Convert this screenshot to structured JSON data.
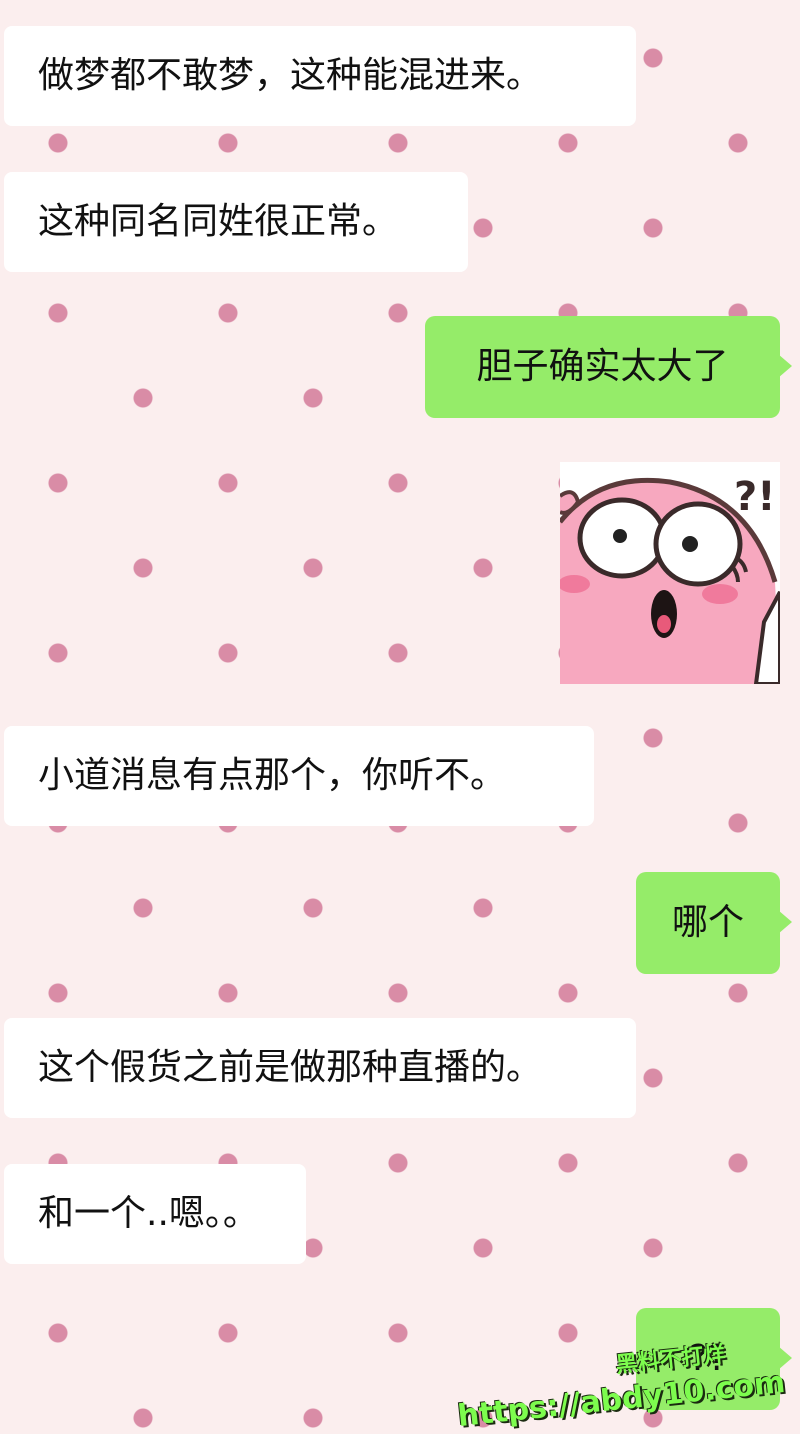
{
  "messages": [
    {
      "side": "left",
      "text": "做梦都不敢梦，这种能混进来。"
    },
    {
      "side": "left",
      "text": "这种同名同姓很正常。"
    },
    {
      "side": "right",
      "text": "胆子确实太大了"
    },
    {
      "side": "right",
      "type": "sticker",
      "sticker_text": "?!"
    },
    {
      "side": "left",
      "text": "小道消息有点那个，你听不。"
    },
    {
      "side": "right",
      "text": "哪个"
    },
    {
      "side": "left",
      "text": "这个假货之前是做那种直播的。"
    },
    {
      "side": "left",
      "text": "和一个..嗯。。"
    },
    {
      "side": "right",
      "text": "??"
    }
  ],
  "watermark": {
    "line1": "黑料不打烊",
    "line2": "https://abdy10.com"
  },
  "colors": {
    "background": "#fbeeee",
    "dot": "#d98ca6",
    "incoming_bubble": "#ffffff",
    "outgoing_bubble": "#95ec69",
    "watermark": "#7dfc4e"
  }
}
